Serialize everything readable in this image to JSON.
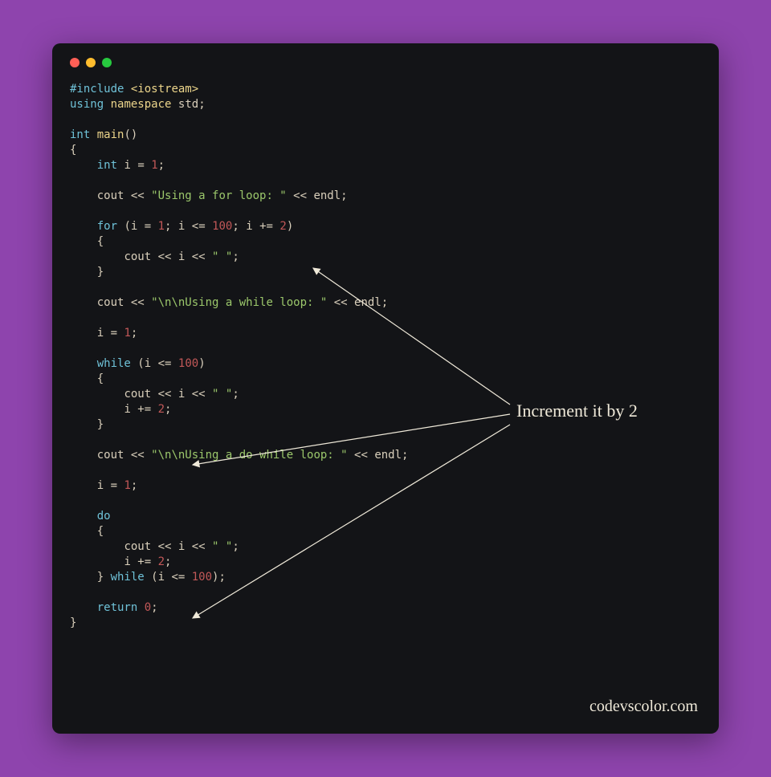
{
  "window": {
    "traffic_colors": {
      "red": "#ff5f56",
      "yellow": "#ffbd2e",
      "green": "#27c93f"
    }
  },
  "annotation": {
    "label": "Increment it by 2"
  },
  "watermark": "codevscolor.com",
  "code": {
    "l01": {
      "pp": "#include",
      "path": "<iostream>"
    },
    "l02": {
      "kw1": "using",
      "kw2": "namespace",
      "id": "std",
      "sc": ";"
    },
    "l03": "",
    "l04": {
      "type": "int",
      "fn": "main",
      "p": "()"
    },
    "l05": "{",
    "l06": {
      "indent": "    ",
      "type": "int",
      "id": "i",
      "eq": " = ",
      "num": "1",
      "sc": ";"
    },
    "l07": "",
    "l08": {
      "indent": "    ",
      "id": "cout",
      "op1": " << ",
      "str": "\"Using a for loop: \"",
      "op2": " << ",
      "id2": "endl",
      "sc": ";"
    },
    "l09": "",
    "l10": {
      "indent": "    ",
      "kw": "for",
      "sp": " (",
      "id1": "i",
      "eq1": " = ",
      "n1": "1",
      "sc1": "; ",
      "id2": "i",
      "op1": " <= ",
      "n2": "100",
      "sc2": "; ",
      "id3": "i",
      "op2": " += ",
      "n3": "2",
      "cp": ")"
    },
    "l11": {
      "indent": "    ",
      "txt": "{"
    },
    "l12": {
      "indent": "        ",
      "id1": "cout",
      "op1": " << ",
      "id2": "i",
      "op2": " << ",
      "str": "\" \"",
      "sc": ";"
    },
    "l13": {
      "indent": "    ",
      "txt": "}"
    },
    "l14": "",
    "l15": {
      "indent": "    ",
      "id": "cout",
      "op1": " << ",
      "str": "\"\\n\\nUsing a while loop: \"",
      "op2": " << ",
      "id2": "endl",
      "sc": ";"
    },
    "l16": "",
    "l17": {
      "indent": "    ",
      "id": "i",
      "eq": " = ",
      "num": "1",
      "sc": ";"
    },
    "l18": "",
    "l19": {
      "indent": "    ",
      "kw": "while",
      "sp": " (",
      "id": "i",
      "op": " <= ",
      "num": "100",
      "cp": ")"
    },
    "l20": {
      "indent": "    ",
      "txt": "{"
    },
    "l21": {
      "indent": "        ",
      "id1": "cout",
      "op1": " << ",
      "id2": "i",
      "op2": " << ",
      "str": "\" \"",
      "sc": ";"
    },
    "l22": {
      "indent": "        ",
      "id": "i",
      "op": " += ",
      "num": "2",
      "sc": ";"
    },
    "l23": {
      "indent": "    ",
      "txt": "}"
    },
    "l24": "",
    "l25": {
      "indent": "    ",
      "id": "cout",
      "op1": " << ",
      "str": "\"\\n\\nUsing a do while loop: \"",
      "op2": " << ",
      "id2": "endl",
      "sc": ";"
    },
    "l26": "",
    "l27": {
      "indent": "    ",
      "id": "i",
      "eq": " = ",
      "num": "1",
      "sc": ";"
    },
    "l28": "",
    "l29": {
      "indent": "    ",
      "kw": "do"
    },
    "l30": {
      "indent": "    ",
      "txt": "{"
    },
    "l31": {
      "indent": "        ",
      "id1": "cout",
      "op1": " << ",
      "id2": "i",
      "op2": " << ",
      "str": "\" \"",
      "sc": ";"
    },
    "l32": {
      "indent": "        ",
      "id": "i",
      "op": " += ",
      "num": "2",
      "sc": ";"
    },
    "l33": {
      "indent": "    ",
      "txt1": "} ",
      "kw": "while",
      "sp": " (",
      "id": "i",
      "opc": " <= ",
      "num": "100",
      "cp": ");"
    },
    "l34": "",
    "l35": {
      "indent": "    ",
      "kw": "return",
      "sp": " ",
      "num": "0",
      "sc": ";"
    },
    "l36": "}"
  }
}
